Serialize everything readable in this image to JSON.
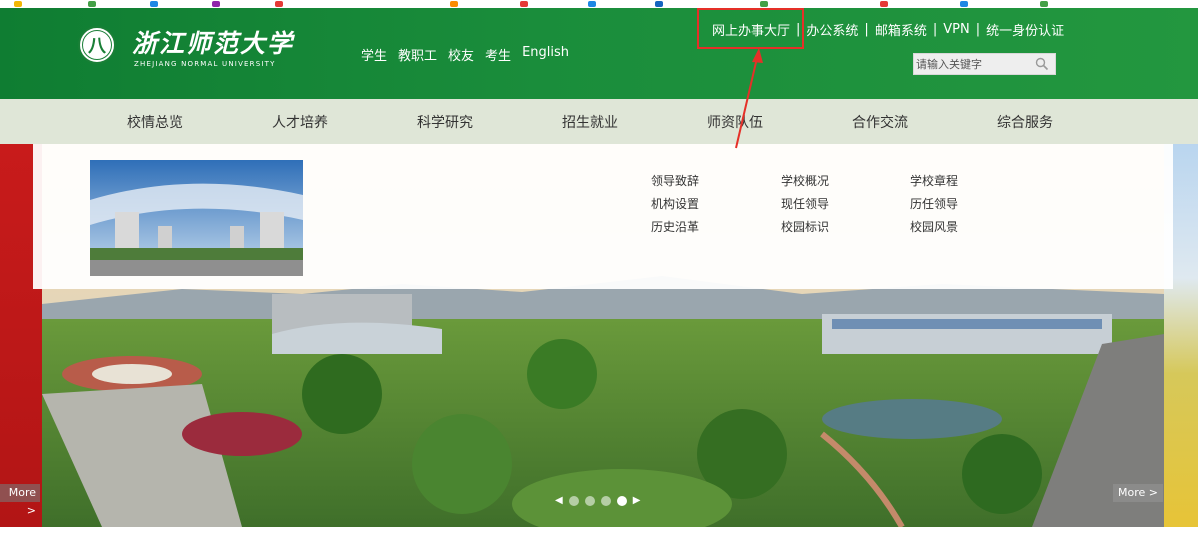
{
  "header": {
    "logo_cn": "浙江师范大学",
    "logo_en": "ZHEJIANG NORMAL UNIVERSITY",
    "quick_nav": [
      "学生",
      "教职工",
      "校友",
      "考生",
      "English"
    ],
    "util_nav": [
      "网上办事大厅",
      "办公系统",
      "邮箱系统",
      "VPN",
      "统一身份认证"
    ],
    "separator": "|",
    "highlighted_item": "网上办事大厅",
    "search_placeholder": "请输入关键字"
  },
  "main_nav": [
    "校情总览",
    "人才培养",
    "科学研究",
    "招生就业",
    "师资队伍",
    "合作交流",
    "综合服务"
  ],
  "dropdown": {
    "links": [
      "领导致辞",
      "学校概况",
      "学校章程",
      "机构设置",
      "现任领导",
      "历任领导",
      "历史沿革",
      "校园标识",
      "校园风景"
    ]
  },
  "banner": {
    "more_left": "More >",
    "more_right": "More >",
    "pager": {
      "slide_count": 4,
      "active_slide": 4
    }
  },
  "colors": {
    "header_green": "#1a8d3b",
    "nav_bg": "#dfe6d7",
    "highlight_red": "#e53028",
    "left_panel_red": "#c81b1b"
  },
  "icons": {
    "search": "magnifier-icon",
    "arrow": "annotation-arrow"
  }
}
